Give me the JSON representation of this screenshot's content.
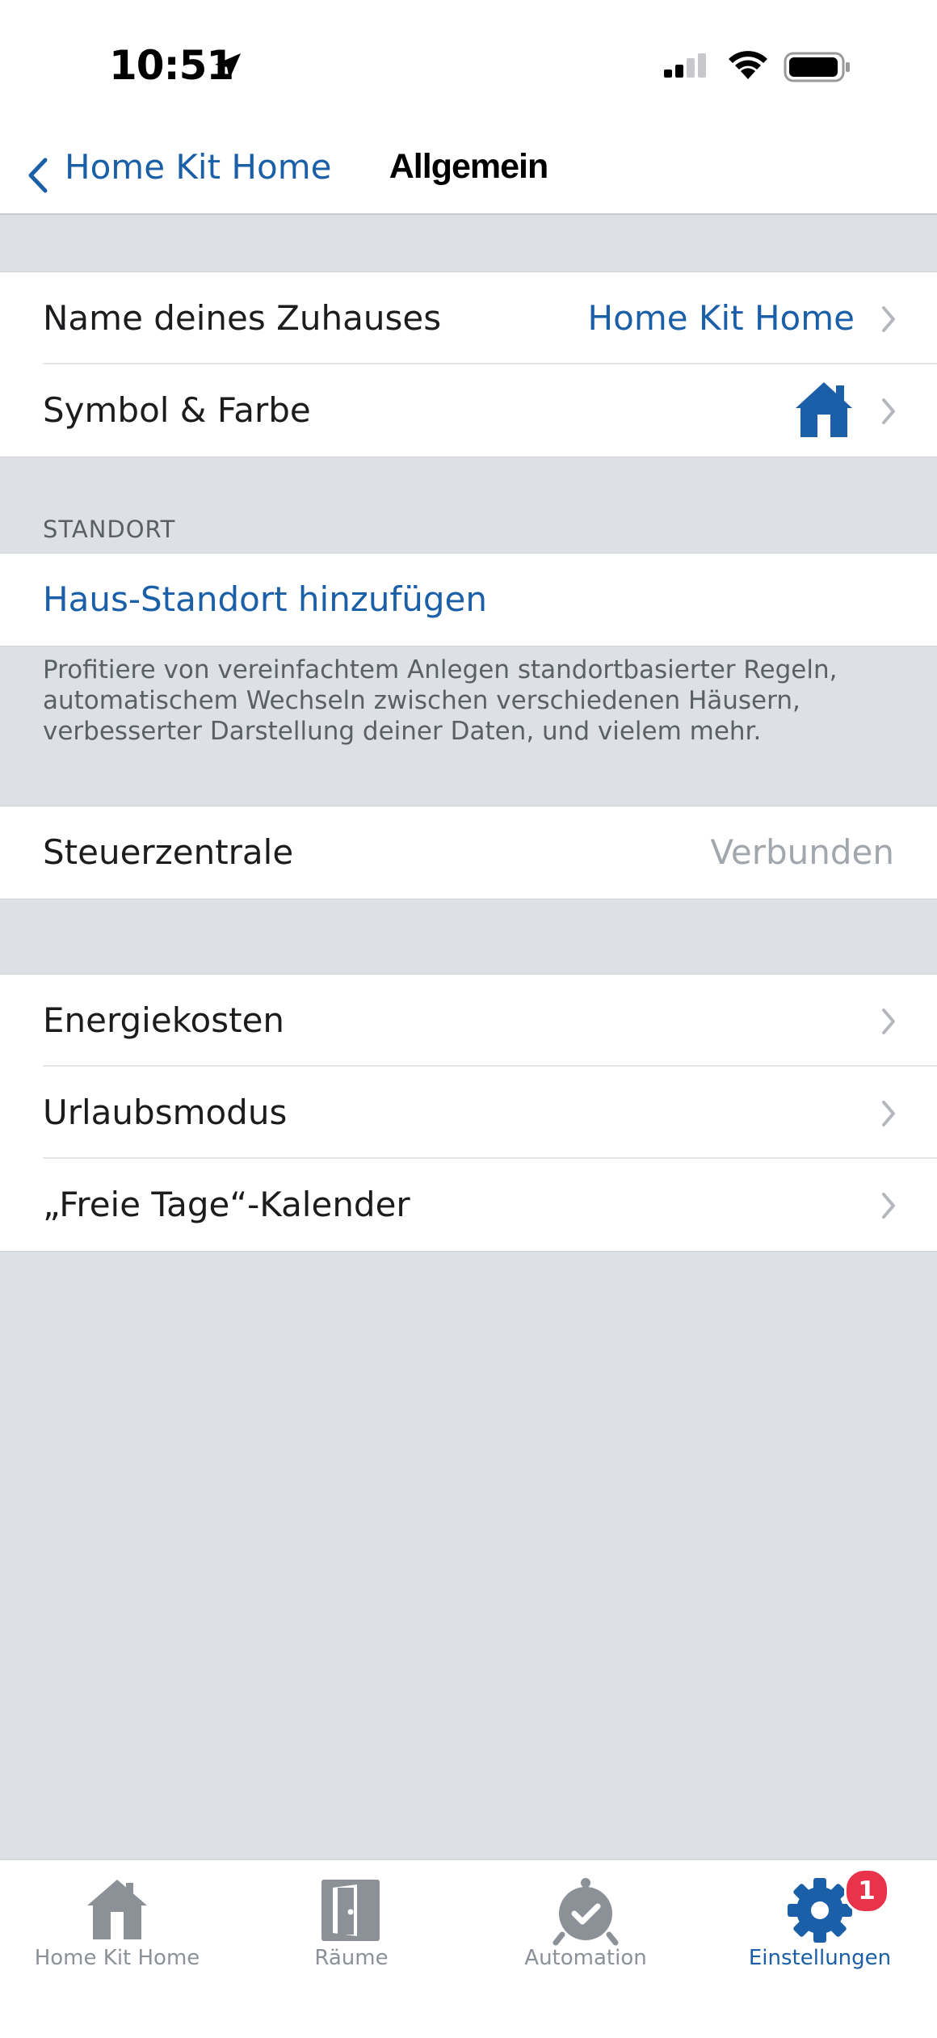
{
  "status_bar": {
    "time": "10:51",
    "icons": [
      "location-arrow-icon",
      "cellular-signal-icon",
      "wifi-icon",
      "battery-icon"
    ]
  },
  "nav": {
    "back_label": "Home Kit Home",
    "title": "Allgemein"
  },
  "home_group": {
    "name_label": "Name deines Zuhauses",
    "name_value": "Home Kit Home",
    "symbol_label": "Symbol & Farbe",
    "symbol_icon": "house-icon",
    "symbol_color": "#1a5fa8"
  },
  "location": {
    "header": "STANDORT",
    "add_label": "Haus-Standort hinzufügen",
    "footnote": "Profitiere von vereinfachtem Anlegen standortbasierter Regeln, automatischem Wechseln zwischen verschiedenen Häusern, verbesserter Darstellung deiner Daten, und vielem mehr."
  },
  "hub": {
    "label": "Steuerzentrale",
    "value": "Verbunden"
  },
  "more": {
    "energy_label": "Energiekosten",
    "vacation_label": "Urlaubsmodus",
    "holidays_label": "„Freie Tage“-Kalender"
  },
  "tabbar": {
    "tabs": [
      {
        "label": "Home Kit Home",
        "icon": "house-icon"
      },
      {
        "label": "Räume",
        "icon": "door-icon"
      },
      {
        "label": "Automation",
        "icon": "automation-clock-icon"
      },
      {
        "label": "Einstellungen",
        "icon": "gear-icon",
        "badge": "1"
      }
    ],
    "active_color": "#1a5fa8",
    "badge_color": "#e8334a"
  }
}
